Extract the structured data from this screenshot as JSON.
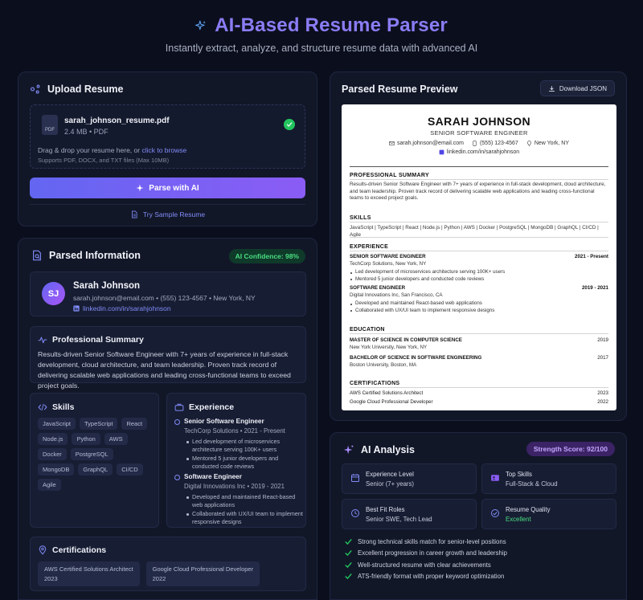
{
  "header": {
    "title": "AI-Based Resume Parser",
    "subtitle": "Instantly extract, analyze, and structure resume data with advanced AI"
  },
  "upload": {
    "title": "Upload Resume",
    "file_name": "sarah_johnson_resume.pdf",
    "file_meta": "2.4 MB • PDF",
    "file_icon_label": "PDF",
    "drop_text": "Drag & drop your resume here, or",
    "browse_link": "click to browse",
    "supports": "Supports PDF, DOCX, and TXT files (Max 10MB)",
    "parse_label": "Parse with AI",
    "sample_label": "Try Sample Resume"
  },
  "parsed": {
    "title": "Parsed Information",
    "confidence": "AI Confidence: 98%",
    "initials": "SJ",
    "name": "Sarah Johnson",
    "contact": "sarah.johnson@email.com • (555) 123-4567 • New York, NY",
    "linkedin": "linkedin.com/in/sarahjohnson",
    "summary_title": "Professional Summary",
    "summary": "Results-driven Senior Software Engineer with 7+ years of experience in full-stack development, cloud architecture, and team leadership. Proven track record of delivering scalable web applications and leading cross-functional teams to exceed project goals.",
    "skills_title": "Skills",
    "skills": [
      "JavaScript",
      "TypeScript",
      "React",
      "Node.js",
      "Python",
      "AWS",
      "Docker",
      "PostgreSQL",
      "MongoDB",
      "GraphQL",
      "CI/CD",
      "Agile"
    ],
    "experience_title": "Experience",
    "experience": [
      {
        "title": "Senior Software Engineer",
        "company": "TechCorp Solutions • 2021 - Present",
        "bullets": [
          "Led development of microservices architecture serving 100K+ users",
          "Mentored 5 junior developers and conducted code reviews"
        ]
      },
      {
        "title": "Software Engineer",
        "company": "Digital Innovations Inc • 2019 - 2021",
        "bullets": [
          "Developed and maintained React-based web applications",
          "Collaborated with UX/UI team to implement responsive designs"
        ]
      }
    ],
    "certifications_title": "Certifications",
    "certifications": [
      {
        "name": "AWS Certified Solutions Architect",
        "year": "2023"
      },
      {
        "name": "Google Cloud Professional Developer",
        "year": "2022"
      }
    ]
  },
  "preview": {
    "title": "Parsed Resume Preview",
    "download_label": "Download JSON",
    "name": "SARAH JOHNSON",
    "role": "SENIOR SOFTWARE ENGINEER",
    "email": "sarah.johnson@email.com",
    "phone": "(555) 123-4567",
    "location": "New York, NY",
    "linkedin": "linkedin.com/in/sarahjohnson",
    "summary_h": "PROFESSIONAL SUMMARY",
    "summary": "Results-driven Senior Software Engineer with 7+ years of experience in full-stack development, cloud architecture, and team leadership. Proven track record of delivering scalable web applications and leading cross-functional teams to exceed project goals.",
    "skills_h": "SKILLS",
    "skills": "JavaScript | TypeScript | React | Node.js | Python | AWS | Docker | PostgreSQL | MongoDB | GraphQL | CI/CD | Agile",
    "experience_h": "EXPERIENCE",
    "exp1_title": "SENIOR SOFTWARE ENGINEER",
    "exp1_dates": "2021 - Present",
    "exp1_company": "TechCorp Solutions, New York, NY",
    "exp1_b1": "Led development of microservices architecture serving 100K+ users",
    "exp1_b2": "Mentored 5 junior developers and conducted code reviews",
    "exp2_title": "SOFTWARE ENGINEER",
    "exp2_dates": "2019 - 2021",
    "exp2_company": "Digital Innovations Inc, San Francisco, CA",
    "exp2_b1": "Developed and maintained React-based web applications",
    "exp2_b2": "Collaborated with UX/UI team to implement responsive designs",
    "education_h": "EDUCATION",
    "edu1_degree": "MASTER OF SCIENCE IN COMPUTER SCIENCE",
    "edu1_year": "2019",
    "edu1_school": "New York University, New York, NY",
    "edu2_degree": "BACHELOR OF SCIENCE IN SOFTWARE ENGINEERING",
    "edu2_year": "2017",
    "edu2_school": "Boston University, Boston, MA",
    "certs_h": "CERTIFICATIONS",
    "cert1": "AWS Certified Solutions Architect",
    "cert1_year": "2023",
    "cert2": "Google Cloud Professional Developer",
    "cert2_year": "2022"
  },
  "analysis": {
    "title": "AI Analysis",
    "strength": "Strength Score: 92/100",
    "metrics": [
      {
        "label": "Experience Level",
        "value": "Senior (7+ years)"
      },
      {
        "label": "Top Skills",
        "value": "Full-Stack & Cloud"
      },
      {
        "label": "Best Fit Roles",
        "value": "Senior SWE, Tech Lead"
      },
      {
        "label": "Resume Quality",
        "value": "Excellent"
      }
    ],
    "checks": [
      "Strong technical skills match for senior-level positions",
      "Excellent progression in career growth and leadership",
      "Well-structured resume with clear achievements",
      "ATS-friendly format with proper keyword optimization"
    ]
  },
  "colors": {
    "background": "#0b0f1d",
    "card": "#121728",
    "accent": "#8b7cf6",
    "success": "#22c55e"
  }
}
